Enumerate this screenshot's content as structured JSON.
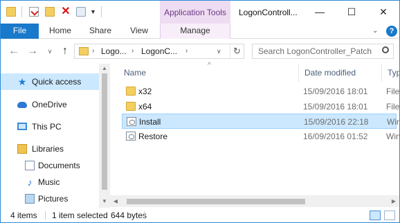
{
  "window": {
    "title": "LogonControll...",
    "contextual_tab_group": "Application Tools",
    "controls": {
      "minimize": "—",
      "maximize": "☐",
      "close": "✕"
    }
  },
  "quick_access_toolbar": {
    "icons": [
      "folder-icon",
      "properties-icon",
      "new-folder-icon",
      "delete-icon",
      "recycle-bin-icon",
      "customize-caret-icon"
    ]
  },
  "ribbon": {
    "tabs": [
      {
        "label": "File"
      },
      {
        "label": "Home"
      },
      {
        "label": "Share"
      },
      {
        "label": "View"
      },
      {
        "label": "Manage"
      }
    ],
    "expand_glyph": "⌄",
    "help_glyph": "?"
  },
  "address_bar": {
    "crumbs": [
      "Logo...",
      "LogonC..."
    ],
    "search_placeholder": "Search LogonController_Patch"
  },
  "nav_pane": {
    "items": [
      {
        "label": "Quick access",
        "icon": "pin-icon",
        "selected": true
      },
      {
        "label": "OneDrive",
        "icon": "onedrive-icon"
      },
      {
        "label": "This PC",
        "icon": "this-pc-icon"
      },
      {
        "label": "Libraries",
        "icon": "libraries-icon"
      },
      {
        "label": "Documents",
        "icon": "documents-icon"
      },
      {
        "label": "Music",
        "icon": "music-icon"
      },
      {
        "label": "Pictures",
        "icon": "pictures-icon"
      }
    ]
  },
  "file_list": {
    "columns": [
      "Name",
      "Date modified",
      "Typ"
    ],
    "rows": [
      {
        "name": "x32",
        "date": "15/09/2016 18:01",
        "type": "File",
        "icon": "folder-icon"
      },
      {
        "name": "x64",
        "date": "15/09/2016 18:01",
        "type": "File",
        "icon": "folder-icon"
      },
      {
        "name": "Install",
        "date": "15/09/2016 22:18",
        "type": "Win",
        "icon": "script-icon",
        "selected": true
      },
      {
        "name": "Restore",
        "date": "16/09/2016 01:52",
        "type": "Win",
        "icon": "script-icon"
      }
    ]
  },
  "status_bar": {
    "item_count": "4 items",
    "selection": "1 item selected",
    "size": "644 bytes"
  },
  "colors": {
    "accent": "#1979ca",
    "selection": "#cce8ff",
    "contextual": "#eedcf2"
  }
}
